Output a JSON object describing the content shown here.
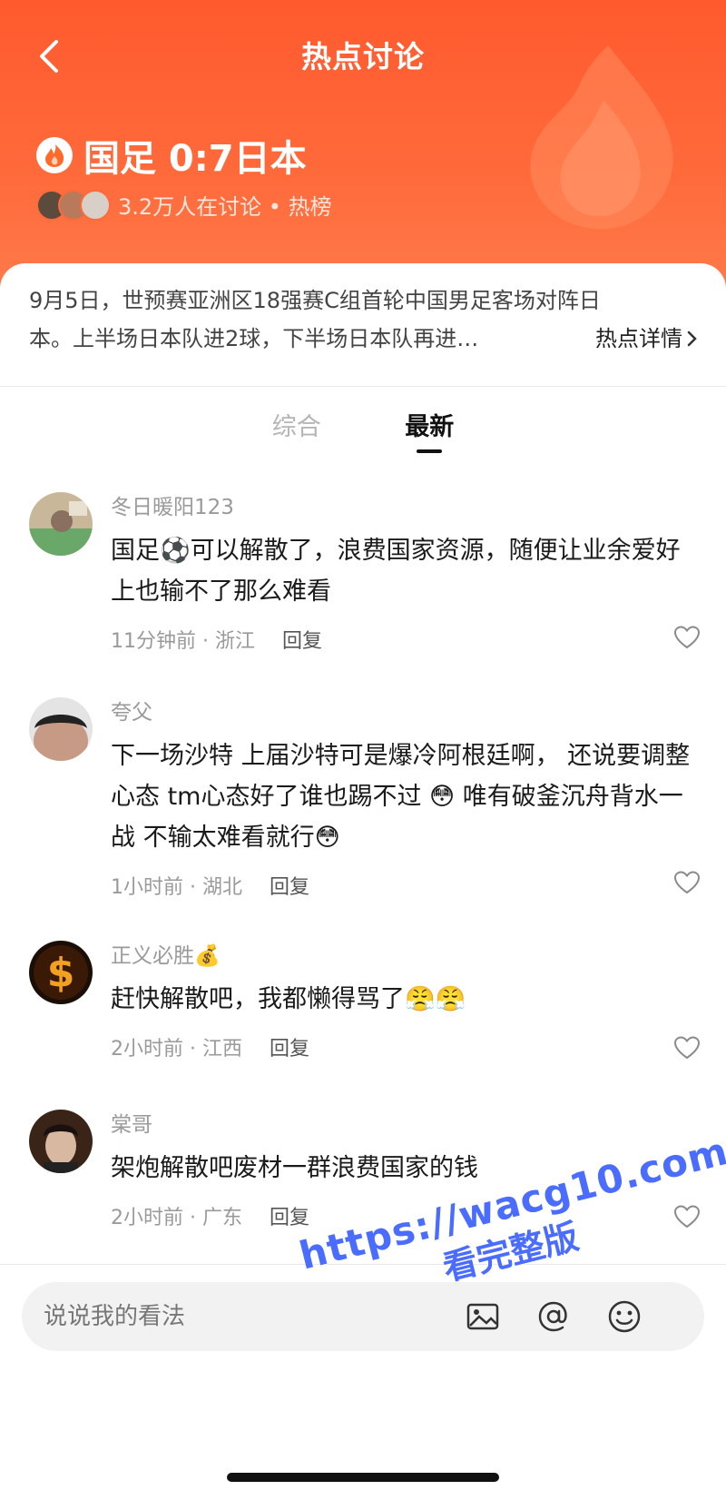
{
  "colors": {
    "brand": "#ff5a2e",
    "watermark": "#4a6cff"
  },
  "header": {
    "title": "热点讨论",
    "topic_title": "国足 0:7日本",
    "meta": "3.2万人在讨论 • 热榜"
  },
  "summary": {
    "line1": "9月5日，世预赛亚洲区18强赛C组首轮中国男足客场对阵日",
    "line2": "本。上半场日本队进2球，下半场日本队再进…",
    "detail_link": "热点详情"
  },
  "tabs": [
    "综合",
    "最新"
  ],
  "comments": [
    {
      "user": "冬日暖阳123",
      "text": "国足⚽可以解散了，浪费国家资源，随便让业余爱好上也输不了那么难看",
      "time": "11分钟前 · 浙江",
      "reply": "回复"
    },
    {
      "user": "夸父",
      "text": "下一场沙特 上届沙特可是爆冷阿根廷啊， 还说要调整心态 tm心态好了谁也踢不过 😳 唯有破釜沉舟背水一战 不输太难看就行😳",
      "time": "1小时前 · 湖北",
      "reply": "回复"
    },
    {
      "user": "正义必胜💰",
      "text": "赶快解散吧，我都懒得骂了😤😤",
      "time": "2小时前 · 江西",
      "reply": "回复"
    },
    {
      "user": "棠哥",
      "text": "架炮解散吧废材一群浪费国家的钱",
      "time": "2小时前 · 广东",
      "reply": "回复"
    }
  ],
  "input": {
    "placeholder": "说说我的看法"
  },
  "watermark": {
    "url": "https://wacg10.com",
    "text": "看完整版"
  }
}
